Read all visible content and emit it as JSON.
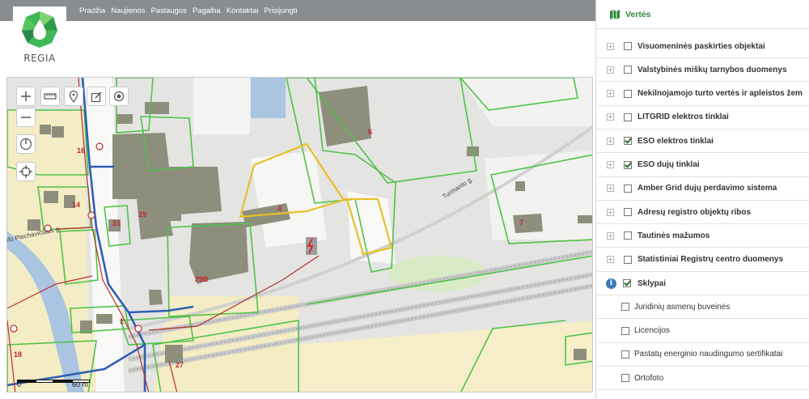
{
  "nav": [
    "Pradžia",
    "Naujienos",
    "Paslaugos",
    "Pagalba",
    "Kontaktai",
    "Prisijungti"
  ],
  "logo_text": "REGIA",
  "map": {
    "plot_labels": [
      "16",
      "14",
      "31",
      "29",
      "4",
      "6",
      "7",
      "29B",
      "1",
      "18",
      "27"
    ],
    "street_1": "Turmanto g.",
    "street_2": "ilo Plechavičiaus g.",
    "scale": {
      "zero": "0",
      "dist": "60 m"
    }
  },
  "panel": {
    "title": "Vertės",
    "layers": [
      {
        "label": "Visuomeninės paskirties objektai",
        "checked": false,
        "expand": true
      },
      {
        "label": "Valstybinės miškų tarnybos duomenys",
        "checked": false,
        "expand": true
      },
      {
        "label": "Nekilnojamojo turto vertės ir apleistos žem",
        "checked": false,
        "expand": true
      },
      {
        "label": "LITGRID elektros tinklai",
        "checked": false,
        "expand": true
      },
      {
        "label": "ESO elektros tinklai",
        "checked": true,
        "expand": true
      },
      {
        "label": "ESO dujų tinklai",
        "checked": true,
        "expand": true
      },
      {
        "label": "Amber Grid dujų perdavimo sistema",
        "checked": false,
        "expand": true
      },
      {
        "label": "Adresų registro objektų ribos",
        "checked": false,
        "expand": true
      },
      {
        "label": "Tautinės mažumos",
        "checked": false,
        "expand": true
      },
      {
        "label": "Statistiniai Registrų centro duomenys",
        "checked": false,
        "expand": true
      },
      {
        "label": "Sklypai",
        "checked": true,
        "expand": false,
        "info": true
      }
    ],
    "sub_layers": [
      {
        "label": "Juridinių asmenų buveinės",
        "checked": false
      },
      {
        "label": "Licencijos",
        "checked": false
      },
      {
        "label": "Pastatų energinio naudingumo sertifikatai",
        "checked": false
      },
      {
        "label": "Ortofoto",
        "checked": false
      }
    ]
  },
  "colors": {
    "accent_green": "#2e8b3d",
    "plot_border": "#4fc24a",
    "gas_line": "#2f5fb5",
    "power_line": "#b8302c",
    "selection": "#e6c02a"
  }
}
